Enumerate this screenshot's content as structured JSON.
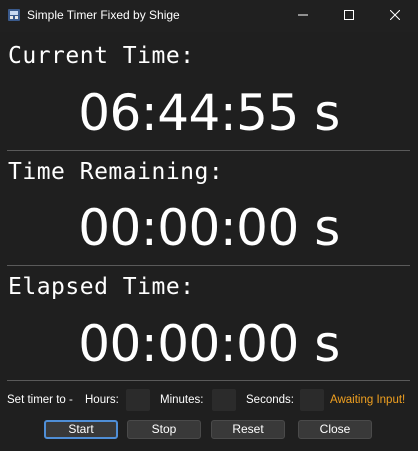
{
  "window": {
    "title": "Simple Timer Fixed by Shige",
    "controls": {
      "minimize_icon": "minimize-icon",
      "maximize_icon": "maximize-icon",
      "close_icon": "close-icon"
    }
  },
  "sections": {
    "current": {
      "label": "Current Time:",
      "value": "06:44:55 s"
    },
    "remaining": {
      "label": "Time Remaining:",
      "value": "00:00:00 s"
    },
    "elapsed": {
      "label": "Elapsed Time:",
      "value": "00:00:00 s"
    }
  },
  "controls": {
    "set_timer_label": "Set timer to -",
    "hours_label": "Hours:",
    "minutes_label": "Minutes:",
    "seconds_label": "Seconds:",
    "hours_value": "",
    "minutes_value": "",
    "seconds_value": "",
    "status": "Awaiting Input!",
    "status_color": "#f0a020"
  },
  "buttons": {
    "start": "Start",
    "stop": "Stop",
    "reset": "Reset",
    "close": "Close"
  },
  "colors": {
    "background": "#1f1f1f",
    "text": "#ffffff",
    "focus_accent": "#4f8ed6"
  }
}
